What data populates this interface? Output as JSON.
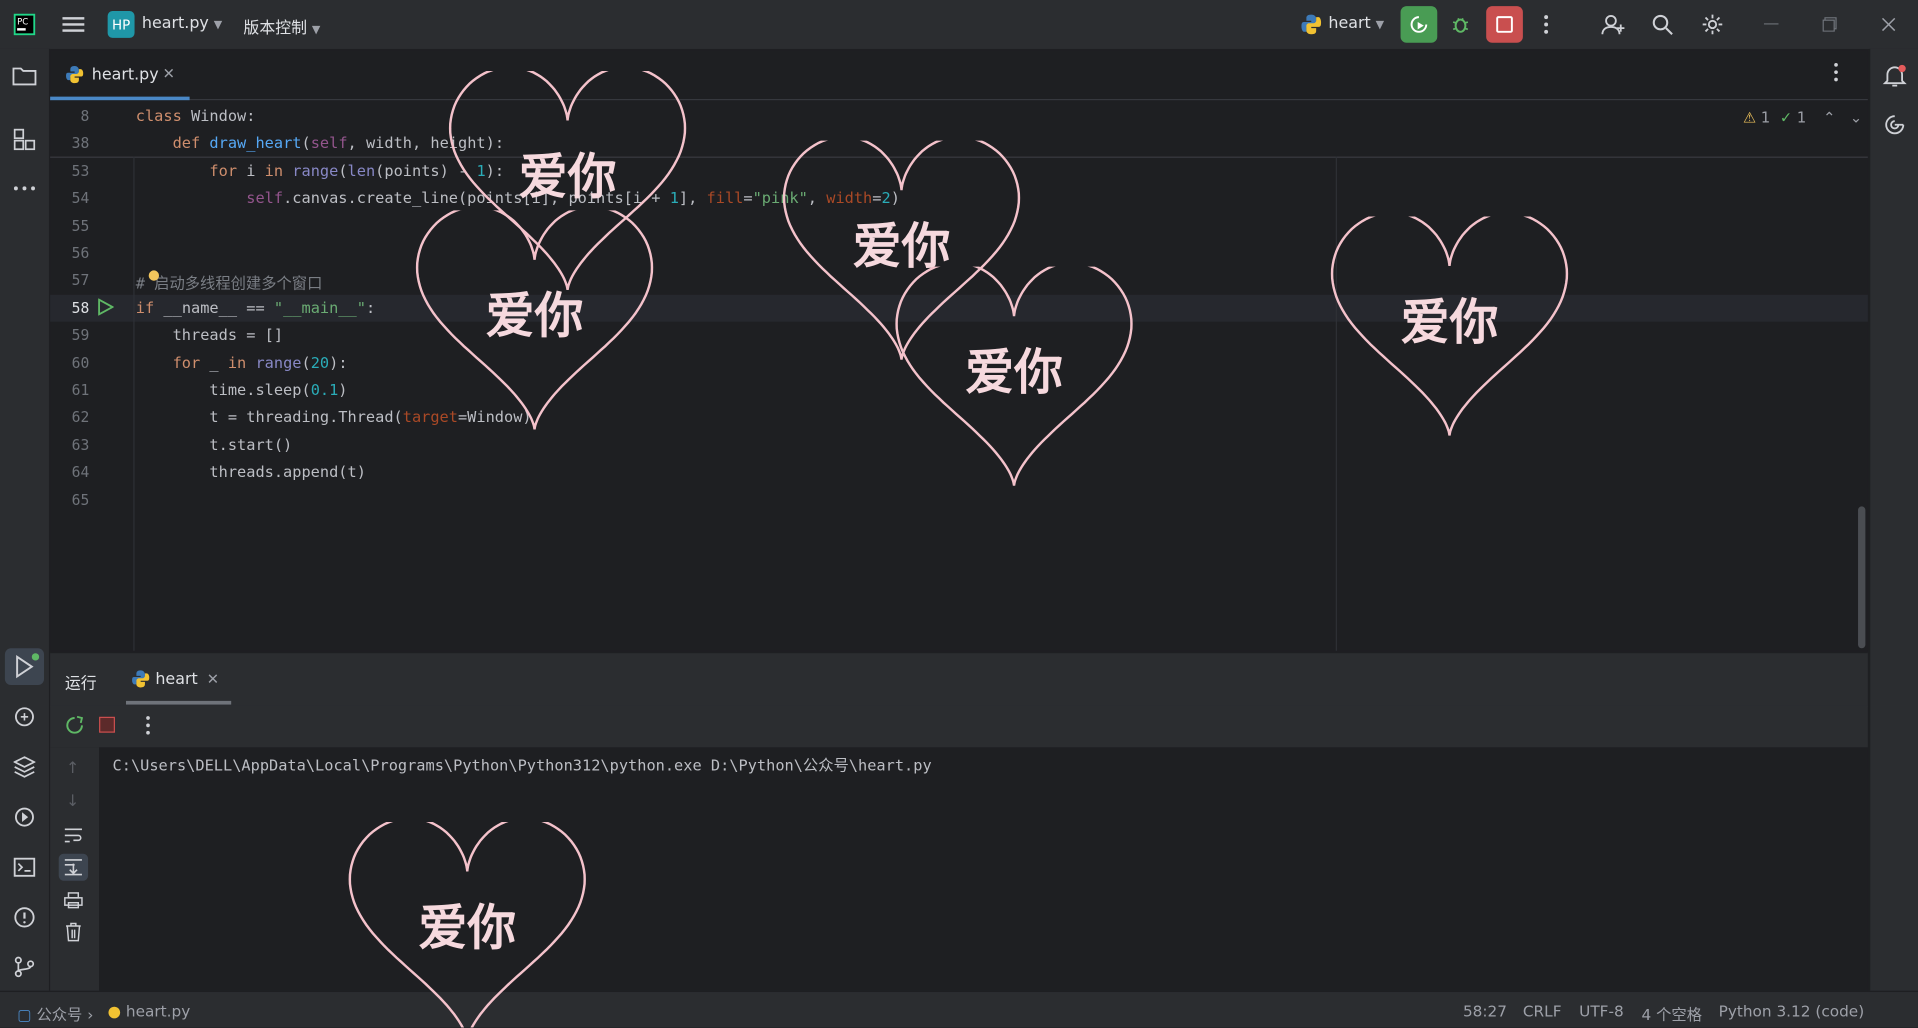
{
  "toolbar": {
    "project_badge": "HP",
    "file_name": "heart.py",
    "vcs_label": "版本控制",
    "run_config": "heart"
  },
  "editor": {
    "tab_label": "heart.py",
    "inspection_warnings": "1",
    "inspection_ok": "1",
    "lines": [
      {
        "num": "8",
        "text": "class Window:"
      },
      {
        "num": "38",
        "text": "    def draw_heart(self, width, height):"
      },
      {
        "num": "53",
        "text": "        for i in range(len(points) - 1):"
      },
      {
        "num": "54",
        "text": "            self.canvas.create_line(points[i], points[i + 1], fill=\"pink\", width=2)"
      },
      {
        "num": "55",
        "text": ""
      },
      {
        "num": "56",
        "text": ""
      },
      {
        "num": "57",
        "text": "# 启动多线程创建多个窗口"
      },
      {
        "num": "58",
        "text": "if __name__ == \"__main__\":"
      },
      {
        "num": "59",
        "text": "    threads = []"
      },
      {
        "num": "60",
        "text": "    for _ in range(20):"
      },
      {
        "num": "61",
        "text": "        time.sleep(0.1)"
      },
      {
        "num": "62",
        "text": "        t = threading.Thread(target=Window)"
      },
      {
        "num": "63",
        "text": "        t.start()"
      },
      {
        "num": "64",
        "text": "        threads.append(t)"
      },
      {
        "num": "65",
        "text": ""
      }
    ]
  },
  "run_panel": {
    "title": "运行",
    "tab_label": "heart",
    "console_line": "C:\\Users\\DELL\\AppData\\Local\\Programs\\Python\\Python312\\python.exe D:\\Python\\公众号\\heart.py"
  },
  "heart_windows": {
    "label": "爱你"
  },
  "statusbar": {
    "project": "公众号",
    "file": "heart.py",
    "position": "58:27",
    "line_sep": "CRLF",
    "encoding": "UTF-8",
    "indent": "4 个空格",
    "interpreter": "Python 3.12 (code)"
  },
  "colors": {
    "accent_run": "#499c54",
    "stop": "#c94f4f",
    "heart_stroke": "#f4c2cb",
    "background": "#1e1f22"
  }
}
